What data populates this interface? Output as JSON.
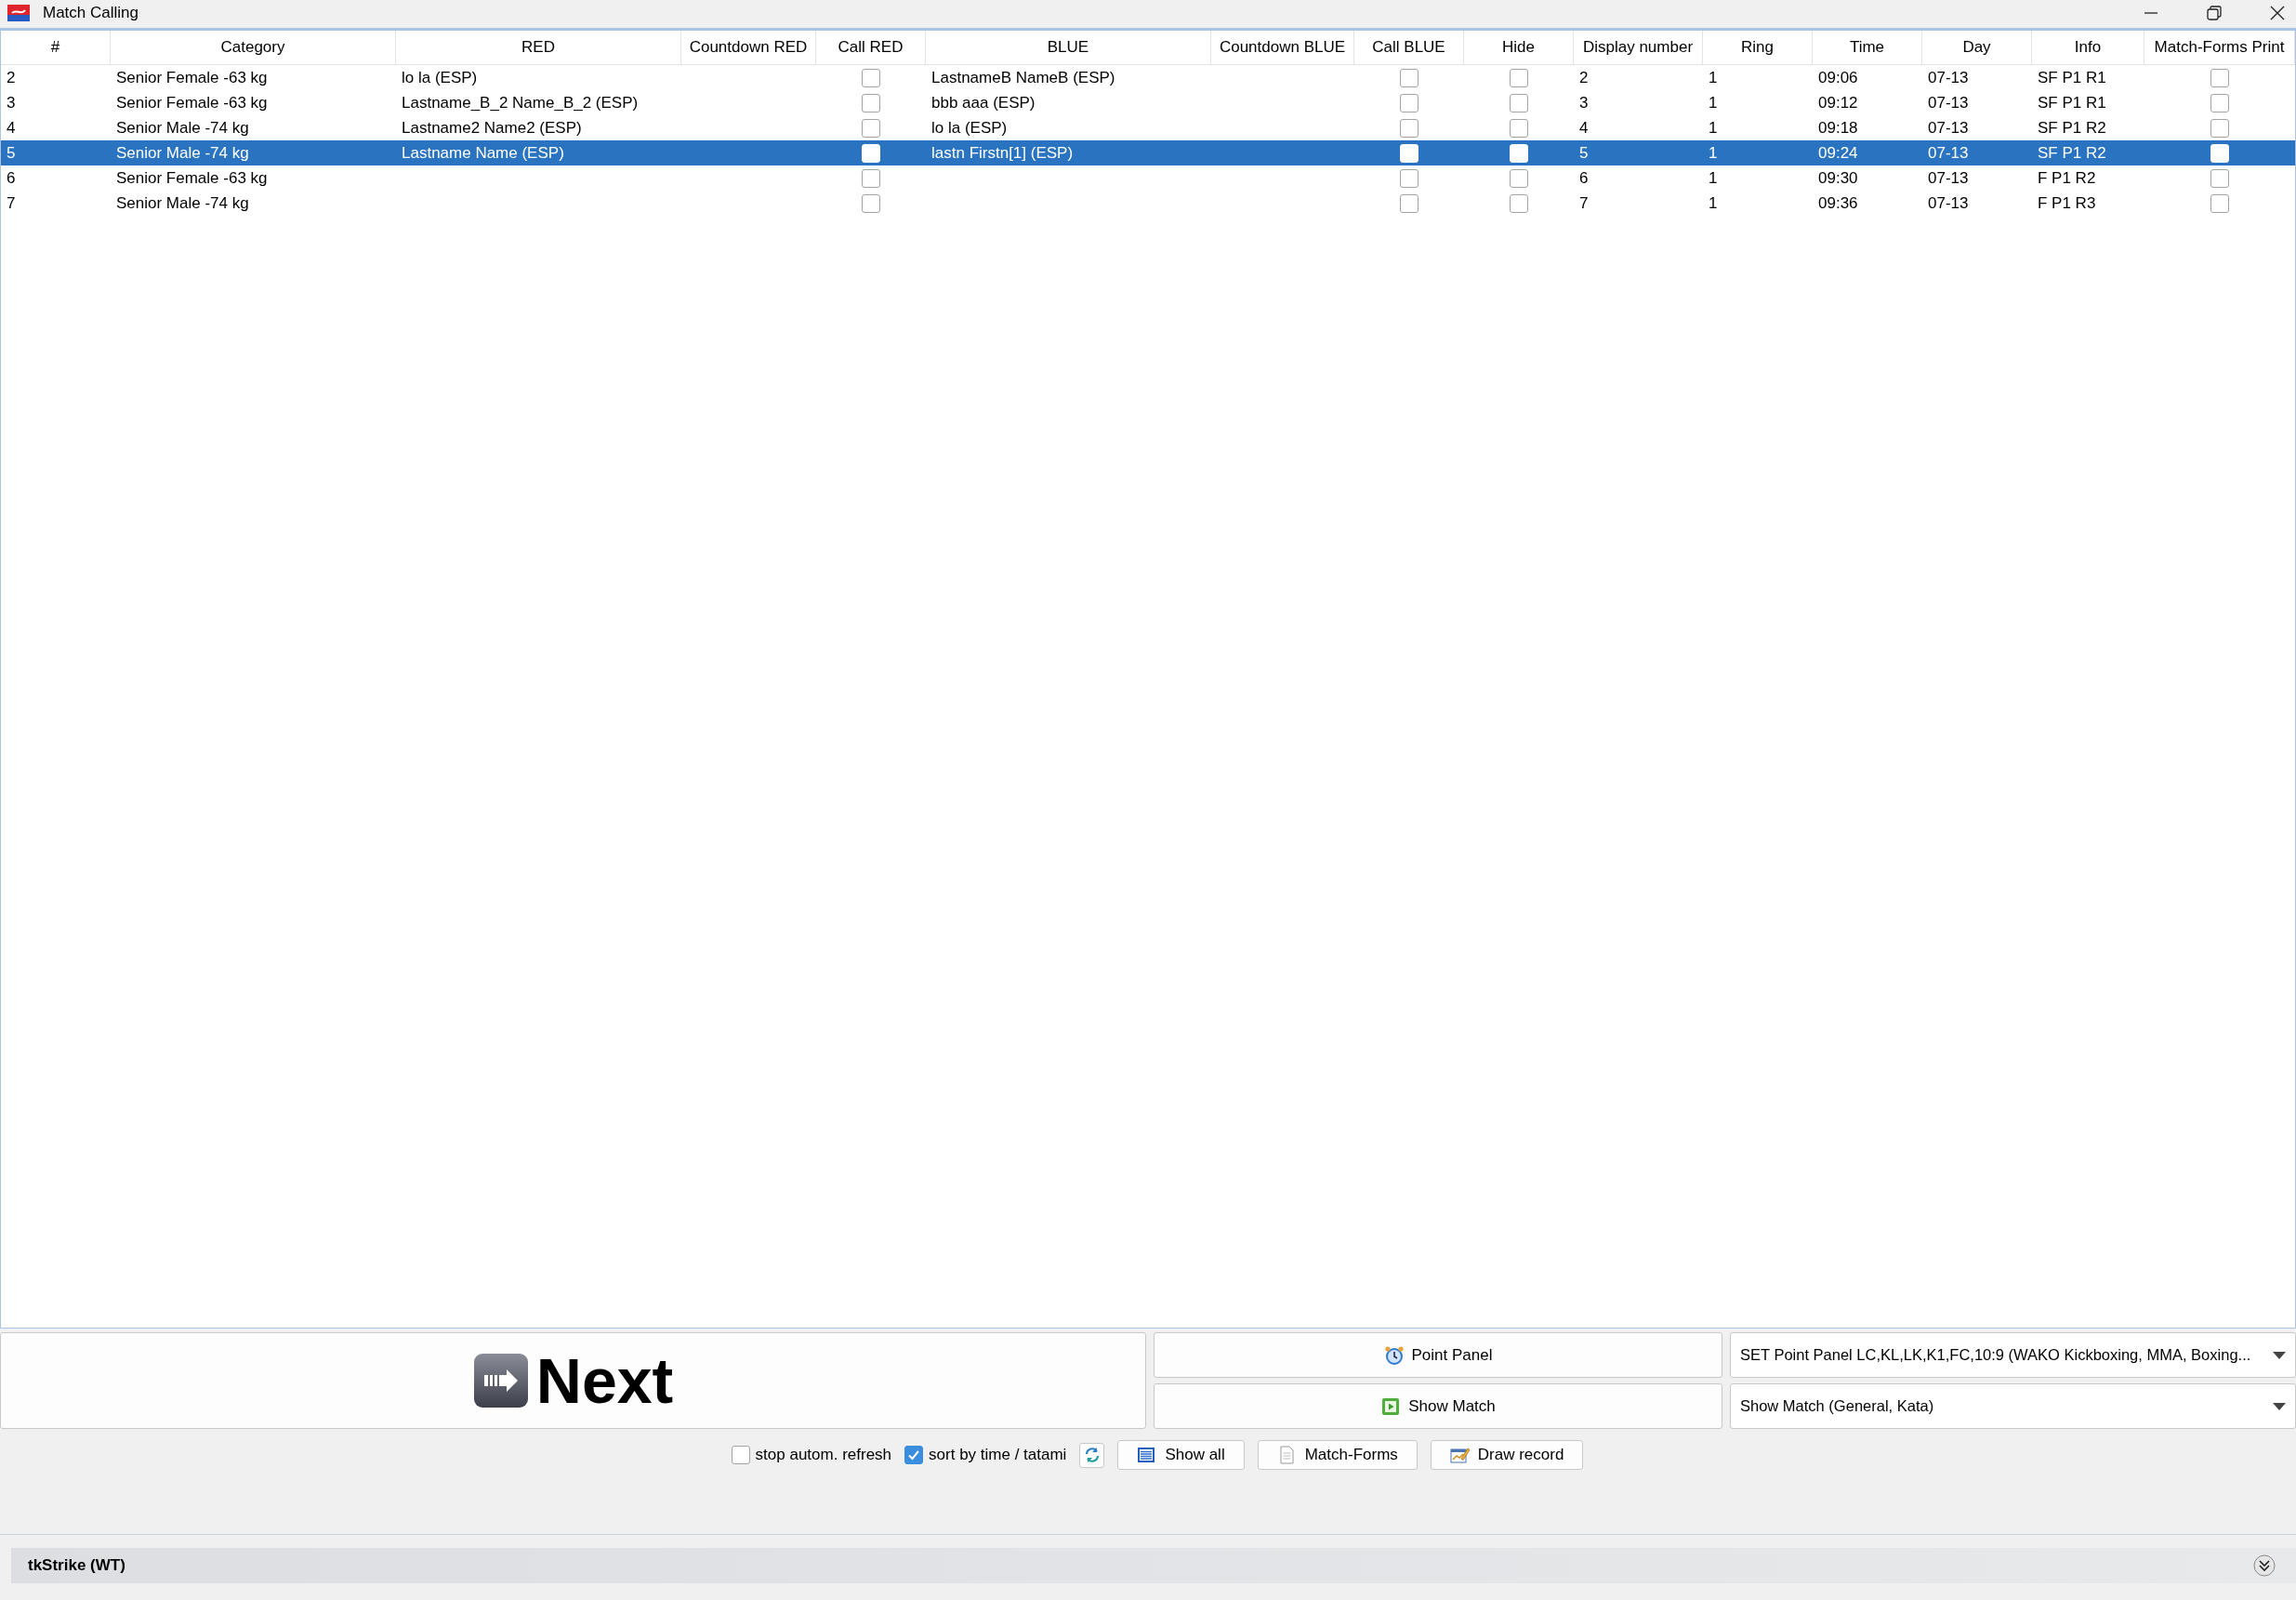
{
  "window": {
    "title": "Match Calling"
  },
  "table": {
    "columns": [
      "#",
      "Category",
      "RED",
      "Countdown RED",
      "Call RED",
      "BLUE",
      "Countdown BLUE",
      "Call BLUE",
      "Hide",
      "Display number",
      "Ring",
      "Time",
      "Day",
      "Info",
      "Match-Forms Print"
    ],
    "rows": [
      {
        "number": "2",
        "category": "Senior Female -63 kg",
        "red": "lo la (ESP)",
        "call_red": false,
        "blue": "LastnameB NameB (ESP)",
        "call_blue": false,
        "hide": false,
        "display_number": "2",
        "ring": "1",
        "time": "09:06",
        "day": "07-13",
        "info": "SF P1 R1",
        "match_forms_print": false,
        "selected": false
      },
      {
        "number": "3",
        "category": "Senior Female -63 kg",
        "red": "Lastname_B_2 Name_B_2 (ESP)",
        "call_red": false,
        "blue": "bbb aaa (ESP)",
        "call_blue": false,
        "hide": false,
        "display_number": "3",
        "ring": "1",
        "time": "09:12",
        "day": "07-13",
        "info": "SF P1 R1",
        "match_forms_print": false,
        "selected": false
      },
      {
        "number": "4",
        "category": "Senior Male -74 kg",
        "red": "Lastname2 Name2 (ESP)",
        "call_red": false,
        "blue": "lo la (ESP)",
        "call_blue": false,
        "hide": false,
        "display_number": "4",
        "ring": "1",
        "time": "09:18",
        "day": "07-13",
        "info": "SF P1 R2",
        "match_forms_print": false,
        "selected": false
      },
      {
        "number": "5",
        "category": "Senior Male -74 kg",
        "red": "Lastname Name (ESP)",
        "call_red": false,
        "blue": "lastn Firstn[1] (ESP)",
        "call_blue": false,
        "hide": false,
        "display_number": "5",
        "ring": "1",
        "time": "09:24",
        "day": "07-13",
        "info": "SF P1 R2",
        "match_forms_print": false,
        "selected": true
      },
      {
        "number": "6",
        "category": "Senior Female -63 kg",
        "call_red": false,
        "call_blue": false,
        "hide": false,
        "display_number": "6",
        "ring": "1",
        "time": "09:30",
        "day": "07-13",
        "info": "F P1 R2",
        "match_forms_print": false,
        "selected": false
      },
      {
        "number": "7",
        "category": "Senior Male -74 kg",
        "call_red": false,
        "call_blue": false,
        "hide": false,
        "display_number": "7",
        "ring": "1",
        "time": "09:36",
        "day": "07-13",
        "info": "F P1 R3",
        "match_forms_print": false,
        "selected": false
      }
    ]
  },
  "controls": {
    "next_button": "Next",
    "action_buttons": [
      "Point Panel",
      "Show Match"
    ],
    "dropdowns": [
      "SET Point Panel LC,KL,LK,K1,FC,10:9 (WAKO Kickboxing, MMA, Boxing...",
      "Show Match (General, Kata)"
    ],
    "options": [
      {
        "label": "stop autom. refresh",
        "checked": false
      },
      {
        "label": "sort by time / tatami",
        "checked": true
      }
    ],
    "buttons": [
      "Show all",
      "Match-Forms",
      "Draw record"
    ]
  },
  "status_bar": {
    "title": "tkStrike (WT)"
  }
}
